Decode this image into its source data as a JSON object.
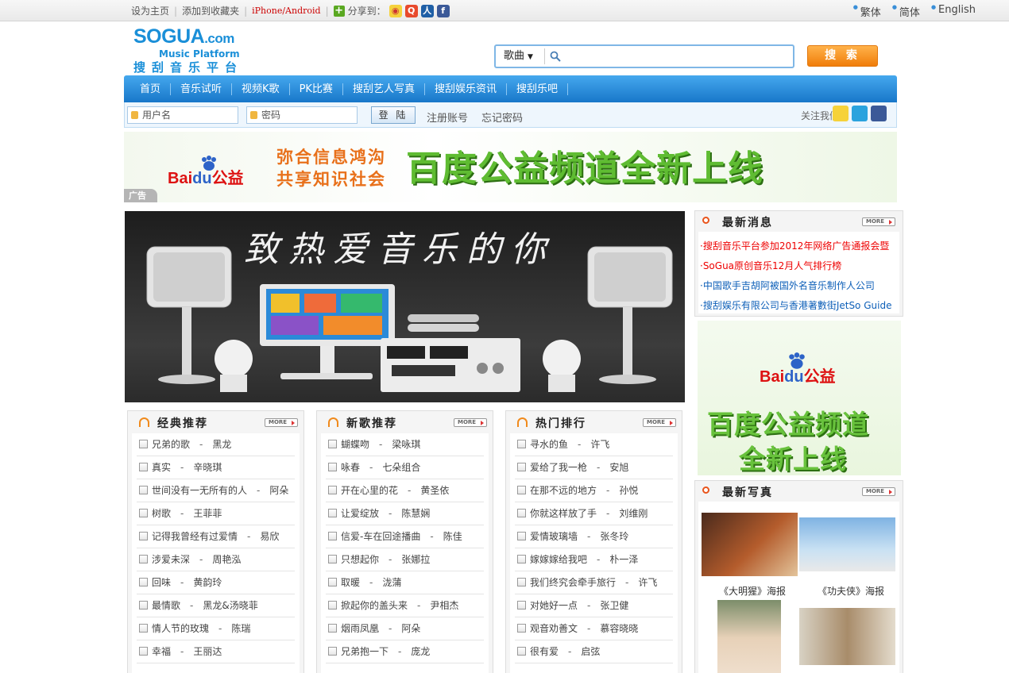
{
  "topbar": {
    "set_home": "设为主页",
    "add_favorite": "添加到收藏夹",
    "mobile": "iPhone/Android",
    "share_to": "分享到：",
    "lang_traditional": "繁体",
    "lang_simplified": "简体",
    "lang_english": "English"
  },
  "logo": {
    "main": "SOGUA",
    "tld": ".com",
    "sub": "Music Platform",
    "cn": "搜刮音乐平台"
  },
  "search": {
    "category": "歌曲",
    "query": "",
    "button": "搜 索"
  },
  "nav": [
    "首页",
    "音乐试听",
    "视频K歌",
    "PK比赛",
    "搜刮艺人写真",
    "搜刮娱乐资讯",
    "搜刮乐吧"
  ],
  "login": {
    "username_placeholder": "用户名",
    "password_placeholder": "密码",
    "login_button": "登 陆",
    "register": "注册账号",
    "forgot": "忘记密码",
    "follow_us": "关注我们："
  },
  "ad_banner": {
    "brand_bai": "Bai",
    "brand_du": "du",
    "brand_cn": "公益",
    "slogan1": "弥合信息鸿沟",
    "slogan2": "共享知识社会",
    "main": "百度公益频道全新上线",
    "tag": "广告"
  },
  "hero": {
    "calligraphy": "致热爱音乐的你"
  },
  "news": {
    "title": "最新消息",
    "more": "MORE",
    "items": [
      {
        "text": "·搜刮音乐平台参加2012年网络广告通报会暨",
        "color": "red"
      },
      {
        "text": "·SoGua原创音乐12月人气排行榜",
        "color": "red"
      },
      {
        "text": "·中国歌手吉胡阿被国外名音乐制作人公司",
        "color": "blue"
      },
      {
        "text": "·搜刮娱乐有限公司与香港著數街JetSo Guide",
        "color": "blue"
      }
    ]
  },
  "side_ad": {
    "brand_bai": "Bai",
    "brand_du": "du",
    "brand_cn": "公益",
    "line1": "百度公益频道",
    "line2": "全新上线"
  },
  "photos": {
    "title": "最新写真",
    "more": "MORE",
    "captions": [
      "《大明猩》海报",
      "《功夫侠》海报"
    ]
  },
  "lists": [
    {
      "title": "经典推荐",
      "more": "MORE",
      "songs": [
        {
          "song": "兄弟的歌",
          "artist": "黑龙"
        },
        {
          "song": "真实",
          "artist": "辛晓琪"
        },
        {
          "song": "世间没有一无所有的人",
          "artist": "阿朵"
        },
        {
          "song": "树歌",
          "artist": "王菲菲"
        },
        {
          "song": "记得我曾经有过爱情",
          "artist": "易欣"
        },
        {
          "song": "涉爱未深",
          "artist": "周艳泓"
        },
        {
          "song": "回味",
          "artist": "黄韵玲"
        },
        {
          "song": "最情歌",
          "artist": "黑龙&汤晓菲"
        },
        {
          "song": "情人节的玫瑰",
          "artist": "陈瑞"
        },
        {
          "song": "幸福",
          "artist": "王丽达"
        }
      ]
    },
    {
      "title": "新歌推荐",
      "more": "MORE",
      "songs": [
        {
          "song": "蝴蝶吻",
          "artist": "梁咏琪"
        },
        {
          "song": "咏春",
          "artist": "七朵组合"
        },
        {
          "song": "开在心里的花",
          "artist": "黄圣依"
        },
        {
          "song": "让爱绽放",
          "artist": "陈慧娴"
        },
        {
          "song": "信爱-车在回途播曲",
          "artist": "陈佳"
        },
        {
          "song": "只想起你",
          "artist": "张娜拉"
        },
        {
          "song": "取暖",
          "artist": "泷蒲"
        },
        {
          "song": "掀起你的盖头来",
          "artist": "尹相杰"
        },
        {
          "song": "烟雨凤凰",
          "artist": "阿朵"
        },
        {
          "song": "兄弟抱一下",
          "artist": "庞龙"
        }
      ]
    },
    {
      "title": "热门排行",
      "more": "MORE",
      "songs": [
        {
          "song": "寻水的鱼",
          "artist": "许飞"
        },
        {
          "song": "爱给了我一枪",
          "artist": "安旭"
        },
        {
          "song": "在那不远的地方",
          "artist": "孙悦"
        },
        {
          "song": "你就这样放了手",
          "artist": "刘维刚"
        },
        {
          "song": "爱情玻璃墙",
          "artist": "张冬玲"
        },
        {
          "song": "嫁嫁嫁给我吧",
          "artist": "朴一泽"
        },
        {
          "song": "我们终究会牵手旅行",
          "artist": "许飞"
        },
        {
          "song": "对她好一点",
          "artist": "张卫健"
        },
        {
          "song": "观音劝善文",
          "artist": "慕容晓晓"
        },
        {
          "song": "很有爱",
          "artist": "启弦"
        }
      ]
    }
  ],
  "colors": {
    "nav_blue": "#2a8fdc",
    "search_orange": "#f07d0a",
    "news_red": "#e00000",
    "news_blue": "#0d5fb8"
  }
}
